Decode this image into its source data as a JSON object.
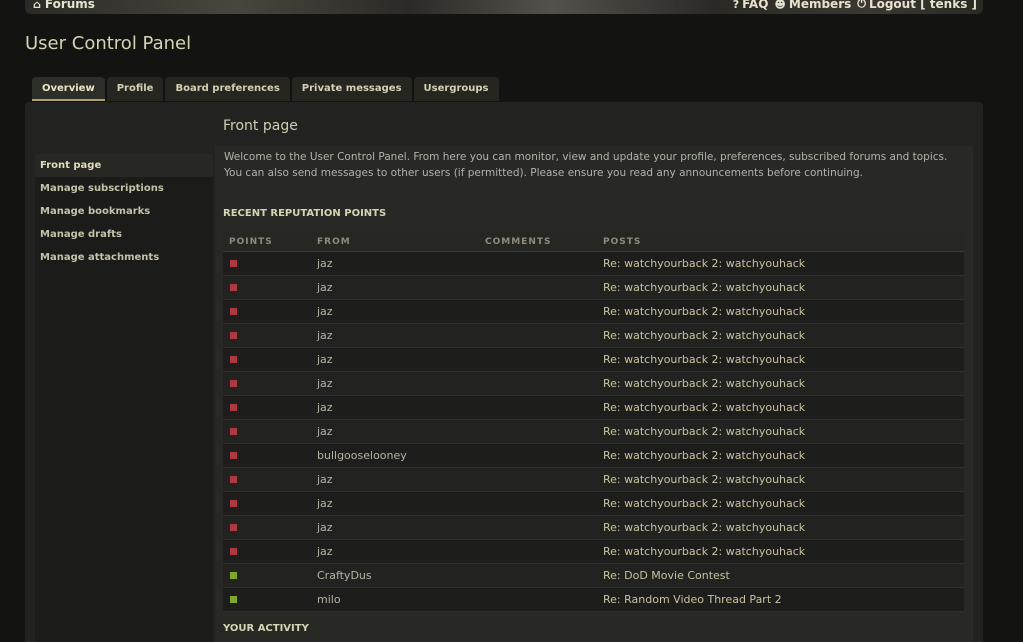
{
  "colors": {
    "negative": "#b0393f",
    "positive": "#7fa82a",
    "accent": "#b09f6a"
  },
  "topnav": {
    "forums": {
      "icon": "home-icon",
      "label": "Forums"
    },
    "faq": {
      "icon": "question-icon",
      "label": "FAQ"
    },
    "members": {
      "icon": "members-icon",
      "label": "Members"
    },
    "logout": {
      "icon": "power-icon",
      "label": "Logout [ tenks ]"
    }
  },
  "page": {
    "title": "User Control Panel"
  },
  "tabs": [
    "Overview",
    "Profile",
    "Board preferences",
    "Private messages",
    "Usergroups"
  ],
  "sidebar": [
    "Front page",
    "Manage subscriptions",
    "Manage bookmarks",
    "Manage drafts",
    "Manage attachments"
  ],
  "content": {
    "title": "Front page",
    "intro": "Welcome to the User Control Panel. From here you can monitor, view and update your profile, preferences, subscribed forums and topics. You can also send messages to other users (if permitted). Please ensure you read any announcements before continuing."
  },
  "reputation": {
    "heading": "RECENT REPUTATION POINTS",
    "columns": [
      "POINTS",
      "FROM",
      "COMMENTS",
      "POSTS"
    ],
    "rows": [
      {
        "points": "negative",
        "from": "jaz",
        "comments": "",
        "post": "Re: watchyourback 2: watchyouhack"
      },
      {
        "points": "negative",
        "from": "jaz",
        "comments": "",
        "post": "Re: watchyourback 2: watchyouhack"
      },
      {
        "points": "negative",
        "from": "jaz",
        "comments": "",
        "post": "Re: watchyourback 2: watchyouhack"
      },
      {
        "points": "negative",
        "from": "jaz",
        "comments": "",
        "post": "Re: watchyourback 2: watchyouhack"
      },
      {
        "points": "negative",
        "from": "jaz",
        "comments": "",
        "post": "Re: watchyourback 2: watchyouhack"
      },
      {
        "points": "negative",
        "from": "jaz",
        "comments": "",
        "post": "Re: watchyourback 2: watchyouhack"
      },
      {
        "points": "negative",
        "from": "jaz",
        "comments": "",
        "post": "Re: watchyourback 2: watchyouhack"
      },
      {
        "points": "negative",
        "from": "jaz",
        "comments": "",
        "post": "Re: watchyourback 2: watchyouhack"
      },
      {
        "points": "negative",
        "from": "bullgooselooney",
        "comments": "",
        "post": "Re: watchyourback 2: watchyouhack"
      },
      {
        "points": "negative",
        "from": "jaz",
        "comments": "",
        "post": "Re: watchyourback 2: watchyouhack"
      },
      {
        "points": "negative",
        "from": "jaz",
        "comments": "",
        "post": "Re: watchyourback 2: watchyouhack"
      },
      {
        "points": "negative",
        "from": "jaz",
        "comments": "",
        "post": "Re: watchyourback 2: watchyouhack"
      },
      {
        "points": "negative",
        "from": "jaz",
        "comments": "",
        "post": "Re: watchyourback 2: watchyouhack"
      },
      {
        "points": "positive",
        "from": "CraftyDus",
        "comments": "",
        "post": "Re: DoD Movie Contest"
      },
      {
        "points": "positive",
        "from": "milo",
        "comments": "",
        "post": "Re: Random Video Thread Part 2"
      }
    ]
  },
  "activity": {
    "heading": "YOUR ACTIVITY"
  }
}
